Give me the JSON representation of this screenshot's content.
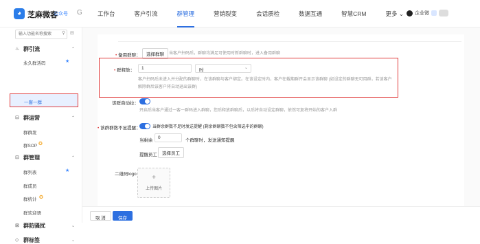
{
  "header": {
    "logo_glyph": "◕",
    "app_name": "芝麻微客",
    "account_label": "公众号",
    "switch_icon": "G",
    "nav": [
      {
        "label": "工作台"
      },
      {
        "label": "客户引流"
      },
      {
        "label": "群管理"
      },
      {
        "label": "营销裂变"
      },
      {
        "label": "会话质检"
      },
      {
        "label": "数据互通"
      },
      {
        "label": "智慧CRM"
      },
      {
        "label": "更多 ⌄"
      }
    ],
    "active_nav": "群管理",
    "user_name": "企业微",
    "accent_color": "#2d6fe0"
  },
  "sidebar": {
    "search_placeholder": "输入功能名称搜索",
    "groups": [
      {
        "label": "群引流",
        "items": [
          "永久群活码",
          "一客一群"
        ]
      },
      {
        "label": "群运营",
        "items": [
          "群群发",
          "群SOP"
        ]
      },
      {
        "label": "群管理",
        "items": [
          "群列表",
          "群成员",
          "群统计",
          "群欢迎语"
        ]
      },
      {
        "label": "群防骚扰",
        "items": []
      },
      {
        "label": "群标签",
        "items": []
      }
    ],
    "active_item": "一客一群"
  },
  "form": {
    "backup_group_label": "备用群聊：",
    "backup_group_button": "选择群聊",
    "backup_group_hint": "当客户扫码后，群聊均满足可使用时新群聊时，进入备用群聊",
    "release_label": "群释放：",
    "release_value": "1",
    "release_unit": "时",
    "release_hint_line1": "客户扫码后未进入并分配的群聊时，在该群聊与客户绑定。在该设定时内，客户在截期群开会显示该群聊 (如设定的群聊无可用群，若该客户",
    "release_hint_line2": "解除群后该客户将自动退出该群)",
    "autopull_label": "该群自动拉：",
    "autopull_hint": "开启后当客户通过一客一群码进入群聊，您后释放群聊后，以后将自动设定群聊，依然可复将开始的客户入群",
    "notfull_label": "该群群数不足提醒：",
    "notfull_hint": "当群余群数不足时发送提醒 (剩余群聊数不包含筛选中的群聊)",
    "remain_prefix": "当剩余",
    "remain_value": "0",
    "remain_suffix": "个群聊时，发送通知提醒",
    "notify_label": "提醒员工：",
    "notify_button": "选择员工",
    "qr_logo_label": "二维码logo：",
    "upload_plus": "+",
    "upload_text": "上传图片"
  },
  "footer": {
    "cancel_label": "取 消",
    "save_label": "保存"
  }
}
